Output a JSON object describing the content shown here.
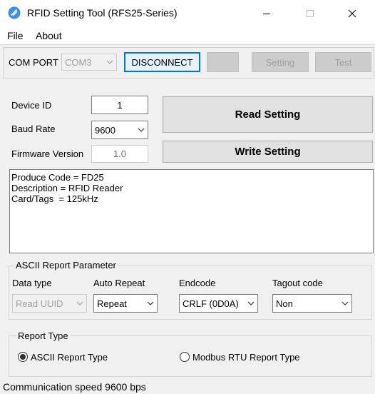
{
  "window": {
    "title": "RFID Setting Tool (RFS25-Series)"
  },
  "menu": [
    {
      "label": "File"
    },
    {
      "label": "About"
    }
  ],
  "com": {
    "label": "COM PORT",
    "port_value": "COM3",
    "disconnect_label": "DISCONNECT",
    "blank_label": "",
    "setting_label": "Setting",
    "test_label": "Test"
  },
  "device": {
    "id_label": "Device ID",
    "id_value": "1",
    "baud_label": "Baud Rate",
    "baud_value": "9600",
    "fw_label": "Firmware Version",
    "fw_value": "1.0",
    "read_label": "Read Setting",
    "write_label": "Write Setting"
  },
  "info": {
    "text": "Produce Code = FD25\nDescription = RFID Reader\nCard/Tags  = 125kHz"
  },
  "ascii": {
    "group_title": "ASCII Report Parameter",
    "data_type_label": "Data type",
    "data_type_value": "Read UUID",
    "auto_repeat_label": "Auto Repeat",
    "auto_repeat_value": "Repeat",
    "endcode_label": "Endcode",
    "endcode_value": "CRLF (0D0A)",
    "tagout_label": "Tagout code",
    "tagout_value": "Non"
  },
  "report_type": {
    "group_title": "Report Type",
    "ascii_label": "ASCII Report Type",
    "ascii_selected": true,
    "modbus_label": "Modbus RTU Report Type",
    "modbus_selected": false
  },
  "status": {
    "text": "Communication speed 9600 bps"
  },
  "colors": {
    "focus_border": "#0078d7",
    "app_icon": "#3a8ee6"
  }
}
